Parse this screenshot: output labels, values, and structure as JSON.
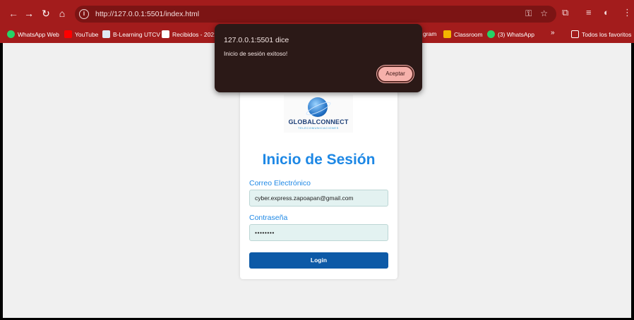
{
  "browser": {
    "url": "http://127.0.0.1:5501/index.html",
    "nav_icons": [
      "back-arrow-icon",
      "forward-arrow-icon",
      "reload-icon",
      "home-icon"
    ],
    "right_icons": [
      "key-icon",
      "star-icon",
      "extensions-icon",
      "reading-list-icon",
      "profile-icon",
      "menu-icon"
    ]
  },
  "bookmarks": {
    "items": [
      "WhatsApp Web",
      "YouTube",
      "B-Learning UTCV",
      "Recibidos - 2021",
      "gram",
      "Classroom",
      "(3) WhatsApp"
    ],
    "more": "»",
    "all_favorites": "Todos los favoritos"
  },
  "login": {
    "logo_name": "GLOBALCONNECT",
    "logo_sub": "TELECOMUNICACIONES",
    "title": "Inicio de Sesión",
    "email_label": "Correo Electrónico",
    "email_value": "cyber.express.zapoapan@gmail.com",
    "password_label": "Contraseña",
    "password_value": "••••••••",
    "button": "Login"
  },
  "dialog": {
    "title": "127.0.0.1:5501 dice",
    "message": "Inicio de sesión exitoso!",
    "accept": "Aceptar"
  }
}
